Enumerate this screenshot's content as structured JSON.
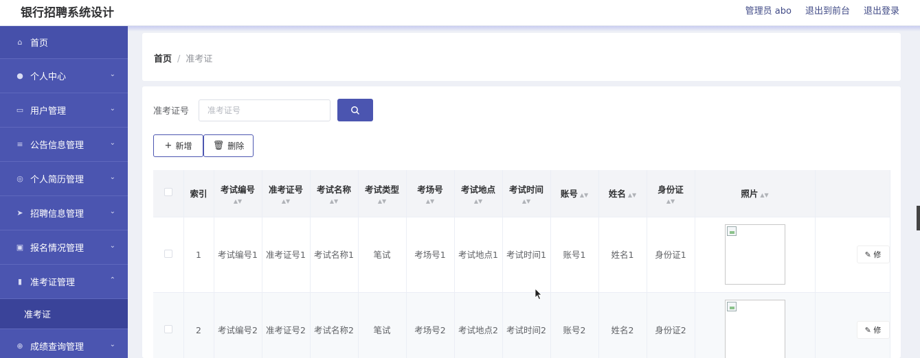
{
  "header": {
    "title": "银行招聘系统设计",
    "user_label": "管理员 abo",
    "front_link": "退出到前台",
    "logout_link": "退出登录"
  },
  "sidebar": {
    "items": [
      {
        "label": "首页",
        "icon": "home-icon"
      },
      {
        "label": "个人中心",
        "icon": "user-icon"
      },
      {
        "label": "用户管理",
        "icon": "users-icon"
      },
      {
        "label": "公告信息管理",
        "icon": "list-icon"
      },
      {
        "label": "个人简历管理",
        "icon": "resume-icon"
      },
      {
        "label": "招聘信息管理",
        "icon": "send-icon"
      },
      {
        "label": "报名情况管理",
        "icon": "briefcase-icon"
      },
      {
        "label": "准考证管理",
        "icon": "chart-icon"
      },
      {
        "label": "成绩查询管理",
        "icon": "globe-icon"
      }
    ],
    "active_sub": "准考证"
  },
  "breadcrumb": {
    "home": "首页",
    "sep": "/",
    "current": "准考证"
  },
  "search": {
    "label": "准考证号",
    "placeholder": "准考证号"
  },
  "actions": {
    "add": "新增",
    "delete": "删除"
  },
  "table": {
    "headers": {
      "index": "索引",
      "exam_no": "考试编号",
      "ticket_no": "准考证号",
      "exam_name": "考试名称",
      "exam_type": "考试类型",
      "room": "考场号",
      "place": "考试地点",
      "time": "考试时间",
      "account": "账号",
      "name": "姓名",
      "id_card": "身份证",
      "photo": "照片"
    },
    "rows": [
      {
        "index": "1",
        "exam_no": "考试编号1",
        "ticket_no": "准考证号1",
        "exam_name": "考试名称1",
        "exam_type": "笔试",
        "room": "考场号1",
        "place": "考试地点1",
        "time": "考试时间1",
        "account": "账号1",
        "name": "姓名1",
        "id_card": "身份证1",
        "edit": "修"
      },
      {
        "index": "2",
        "exam_no": "考试编号2",
        "ticket_no": "准考证号2",
        "exam_name": "考试名称2",
        "exam_type": "笔试",
        "room": "考场号2",
        "place": "考试地点2",
        "time": "考试时间2",
        "account": "账号2",
        "name": "姓名2",
        "id_card": "身份证2",
        "edit": "修"
      }
    ]
  },
  "colors": {
    "primary": "#4b55b0",
    "sidebar_bg": "#4b55b0",
    "submenu_bg": "#3a4399"
  }
}
